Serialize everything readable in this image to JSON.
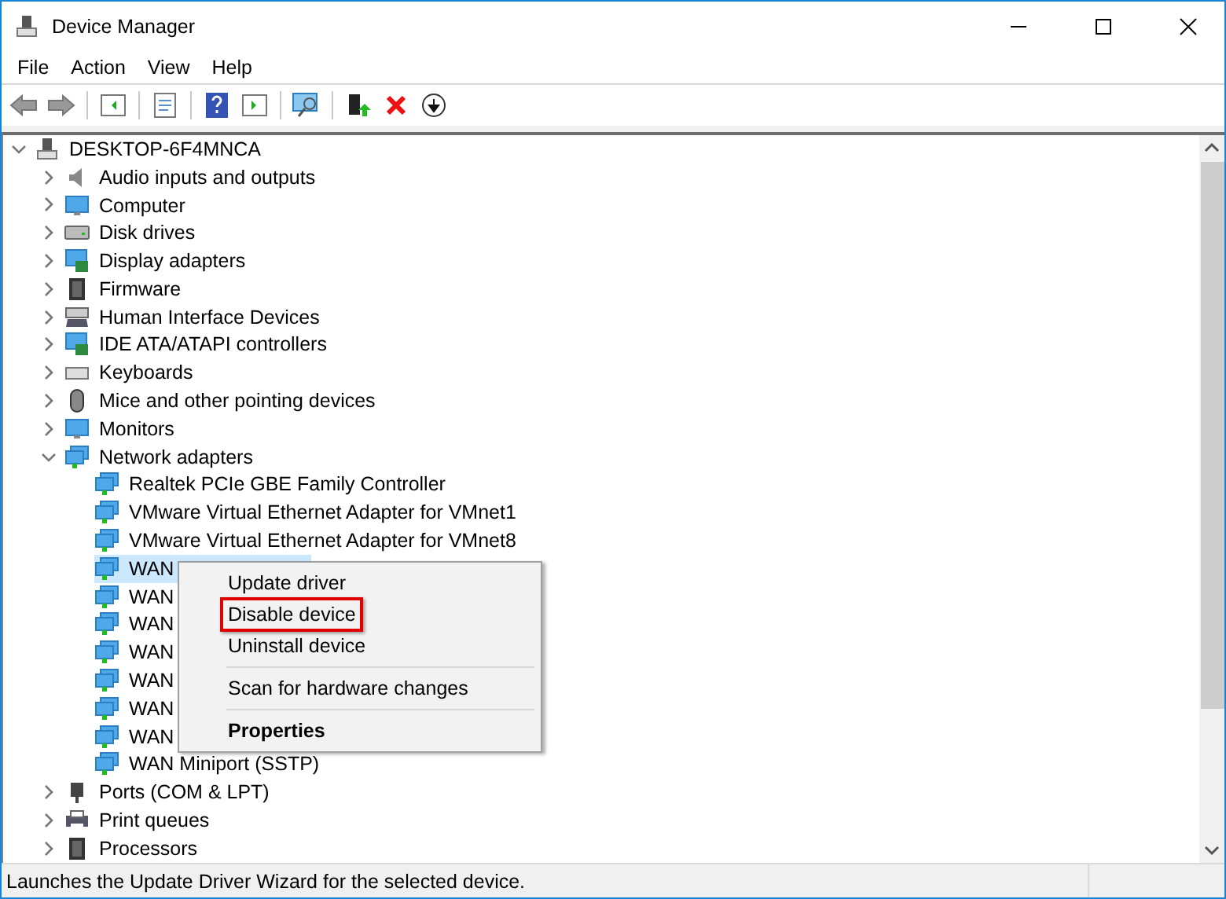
{
  "window": {
    "title": "Device Manager"
  },
  "menu": [
    "File",
    "Action",
    "View",
    "Help"
  ],
  "tree": {
    "label": "DESKTOP-6F4MNCA",
    "kind": "computer",
    "expanded": true,
    "children": [
      {
        "label": "Audio inputs and outputs",
        "kind": "audio",
        "expanded": false
      },
      {
        "label": "Computer",
        "kind": "monitor",
        "expanded": false
      },
      {
        "label": "Disk drives",
        "kind": "disk",
        "expanded": false
      },
      {
        "label": "Display adapters",
        "kind": "display",
        "expanded": false
      },
      {
        "label": "Firmware",
        "kind": "chip",
        "expanded": false
      },
      {
        "label": "Human Interface Devices",
        "kind": "hid",
        "expanded": false
      },
      {
        "label": "IDE ATA/ATAPI controllers",
        "kind": "display",
        "expanded": false
      },
      {
        "label": "Keyboards",
        "kind": "keyboard",
        "expanded": false
      },
      {
        "label": "Mice and other pointing devices",
        "kind": "mouse",
        "expanded": false
      },
      {
        "label": "Monitors",
        "kind": "monitor",
        "expanded": false
      },
      {
        "label": "Network adapters",
        "kind": "network",
        "expanded": true,
        "children": [
          {
            "label": "Realtek PCIe GBE Family Controller",
            "kind": "network",
            "selected": false
          },
          {
            "label": "VMware Virtual Ethernet Adapter for VMnet1",
            "kind": "network",
            "selected": false
          },
          {
            "label": "VMware Virtual Ethernet Adapter for VMnet8",
            "kind": "network",
            "selected": false
          },
          {
            "label": "WAN",
            "kind": "network",
            "selected": true
          },
          {
            "label": "WAN",
            "kind": "network",
            "selected": false
          },
          {
            "label": "WAN",
            "kind": "network",
            "selected": false
          },
          {
            "label": "WAN",
            "kind": "network",
            "selected": false
          },
          {
            "label": "WAN",
            "kind": "network",
            "selected": false
          },
          {
            "label": "WAN",
            "kind": "network",
            "selected": false
          },
          {
            "label": "WAN",
            "kind": "network",
            "selected": false
          },
          {
            "label": "WAN Miniport (SSTP)",
            "kind": "network",
            "selected": false
          }
        ]
      },
      {
        "label": "Ports (COM & LPT)",
        "kind": "port",
        "expanded": false
      },
      {
        "label": "Print queues",
        "kind": "printer",
        "expanded": false
      },
      {
        "label": "Processors",
        "kind": "chip",
        "expanded": false
      }
    ]
  },
  "context_menu": [
    {
      "kind": "item",
      "label": "Update driver",
      "bold": false,
      "outlined": false
    },
    {
      "kind": "item",
      "label": "Disable device",
      "bold": false,
      "outlined": true
    },
    {
      "kind": "item",
      "label": "Uninstall device",
      "bold": false,
      "outlined": false
    },
    {
      "kind": "separator"
    },
    {
      "kind": "item",
      "label": "Scan for hardware changes",
      "bold": false,
      "outlined": false
    },
    {
      "kind": "separator"
    },
    {
      "kind": "item",
      "label": "Properties",
      "bold": true,
      "outlined": false
    }
  ],
  "status_bar": "Launches the Update Driver Wizard for the selected device."
}
